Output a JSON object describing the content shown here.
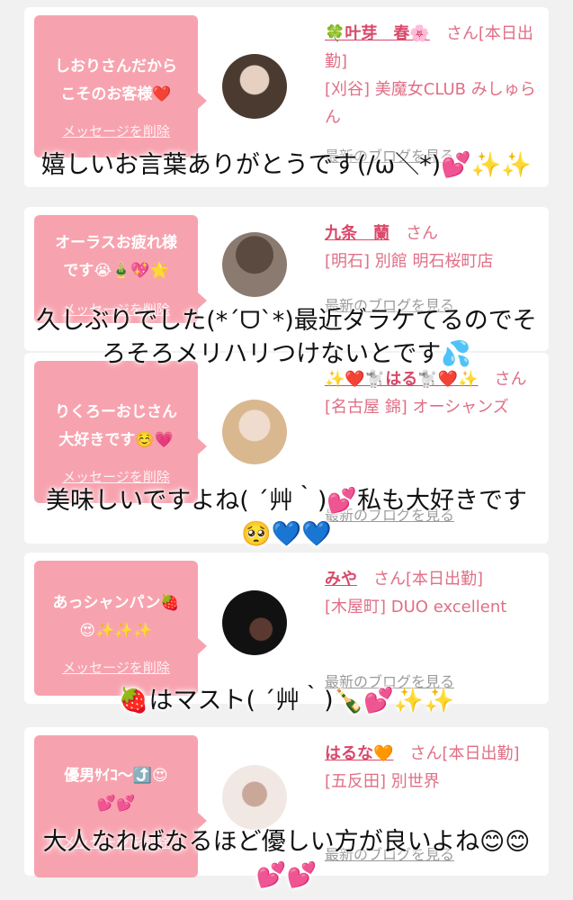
{
  "cards": [
    {
      "bubble_text": "しおりさんだから\nこそのお客様❤️",
      "delete_label": "メッセージを削除",
      "name": "🍀叶芽　春🌸",
      "suffix": "さん[本日出勤]",
      "location": "[刈谷] 美魔女CLUB みしゅらん",
      "blog_label": "最新のブログを見る"
    },
    {
      "bubble_text": "オーラスお疲れ様\nです😭🎍💖🌟",
      "delete_label": "メッセージを削除",
      "name": "九条　蘭",
      "suffix": "さん",
      "location": "[明石] 別館 明石桜町店",
      "blog_label": "最新のブログを見る"
    },
    {
      "bubble_text": "りくろーおじさん\n大好きです☺️💗",
      "delete_label": "メッセージを削除",
      "name": "✨❤️🐩はる🐩❤️✨",
      "suffix": "さん",
      "location": "[名古屋 錦] オーシャンズ",
      "blog_label": "最新のブログを見る"
    },
    {
      "bubble_text": "あっシャンパン🍓\n😍✨✨✨",
      "delete_label": "メッセージを削除",
      "name": "みや",
      "suffix": "さん[本日出勤]",
      "location": "[木屋町] DUO excellent",
      "blog_label": "最新のブログを見る"
    },
    {
      "bubble_text": "優男ｻｲｺ〜⤴️😍\n💕💕",
      "delete_label": "メッセージを削除",
      "name": "はるな🧡",
      "suffix": "さん[本日出勤]",
      "location": "[五反田] 別世界",
      "blog_label": "最新のブログを見る"
    }
  ],
  "overlays": [
    "嬉しいお言葉ありがとうです(/ω＼*)💕✨✨",
    "久しぶりでした(*´ᗜ`*)最近ダラケてるのでそ\nろそろメリハリつけないとです💦",
    "美味しいですよね( ´艸｀)💕私も大好きです\n🥺💙💙",
    "🍓はマスト( ´艸｀)🍾💕✨✨",
    "大人なればなるほど優しい方が良いよね😊😊\n💕💕"
  ]
}
